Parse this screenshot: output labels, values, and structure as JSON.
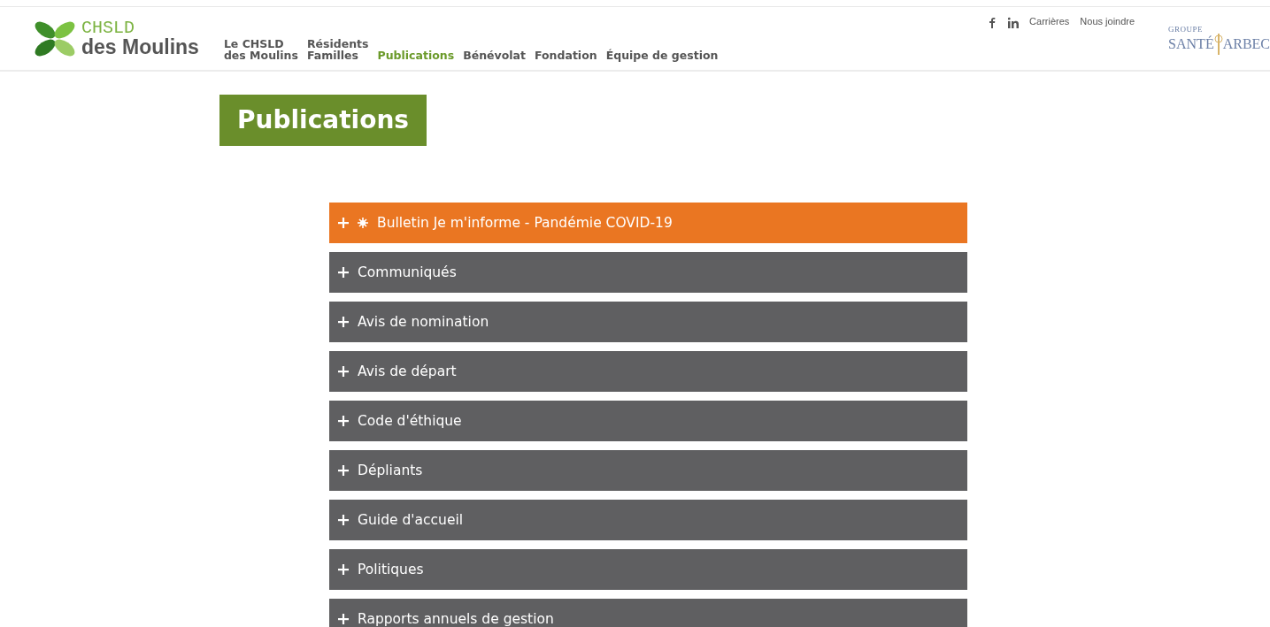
{
  "header": {
    "logo": {
      "line1": "CHSLD",
      "line2": "des Moulins"
    },
    "nav": [
      {
        "label": "Le CHSLD\ndes Moulins",
        "selected": false
      },
      {
        "label": "Résidents\nFamilles",
        "selected": false
      },
      {
        "label": "Publications",
        "selected": true
      },
      {
        "label": "Bénévolat",
        "selected": false
      },
      {
        "label": "Fondation",
        "selected": false
      },
      {
        "label": "Équipe de gestion",
        "selected": false
      }
    ],
    "top_links": [
      "Carrières",
      "Nous joindre"
    ],
    "partner_logo": {
      "small": "GROUPE",
      "left": "SANTÉ",
      "right": "ARBEC"
    }
  },
  "page_title": "Publications",
  "accordion": [
    {
      "label": "Bulletin Je m'informe - Pandémie COVID-19",
      "kind": "highlight",
      "expanded": false
    },
    {
      "label": "Communiqués",
      "kind": "normal",
      "expanded": false
    },
    {
      "label": "Avis de nomination",
      "kind": "normal",
      "expanded": false
    },
    {
      "label": "Avis de départ",
      "kind": "normal",
      "expanded": false
    },
    {
      "label": "Code d'éthique",
      "kind": "normal",
      "expanded": false
    },
    {
      "label": "Dépliants",
      "kind": "normal",
      "expanded": false
    },
    {
      "label": "Guide d'accueil",
      "kind": "normal",
      "expanded": false
    },
    {
      "label": "Politiques",
      "kind": "normal",
      "expanded": false
    },
    {
      "label": "Rapports annuels de gestion",
      "kind": "normal",
      "expanded": false
    }
  ]
}
